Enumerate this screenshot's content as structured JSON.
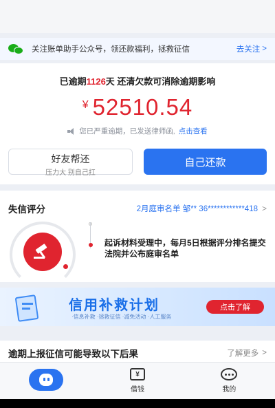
{
  "wechat_bar": {
    "text": "关注账单助手公众号，领还款福利，拯救征信",
    "link": "去关注"
  },
  "overdue": {
    "prefix": "已逾期",
    "days": "1126",
    "suffix": "天 还清欠款可消除逾期影响",
    "currency": "¥",
    "amount": "52510.54",
    "notice": "您已严重逾期，已发送律师函,",
    "notice_link": "点击查看",
    "btn_friend": "好友帮还",
    "btn_friend_sub": "压力大 别自己扛",
    "btn_self": "自己还款"
  },
  "credit": {
    "title": "失信评分",
    "right_text": "2月庭审名单 邹** 36************418",
    "description": "起诉材料受理中，每月5日根据评分排名提交法院并公布庭审名单"
  },
  "banner": {
    "title": "信用补救计划",
    "subtitle": "·信息补救 ·拯救征信 ·减免活动 ·人工服务",
    "button": "点击了解"
  },
  "consequence": {
    "title": "逾期上报征信可能导致以下后果",
    "more": "了解更多"
  },
  "tabbar": {
    "borrow": "借钱",
    "borrow_icon_glyph": "¥",
    "mine": "我的"
  },
  "colors": {
    "accent_blue": "#2a73f0",
    "alert_red": "#e0242f"
  }
}
